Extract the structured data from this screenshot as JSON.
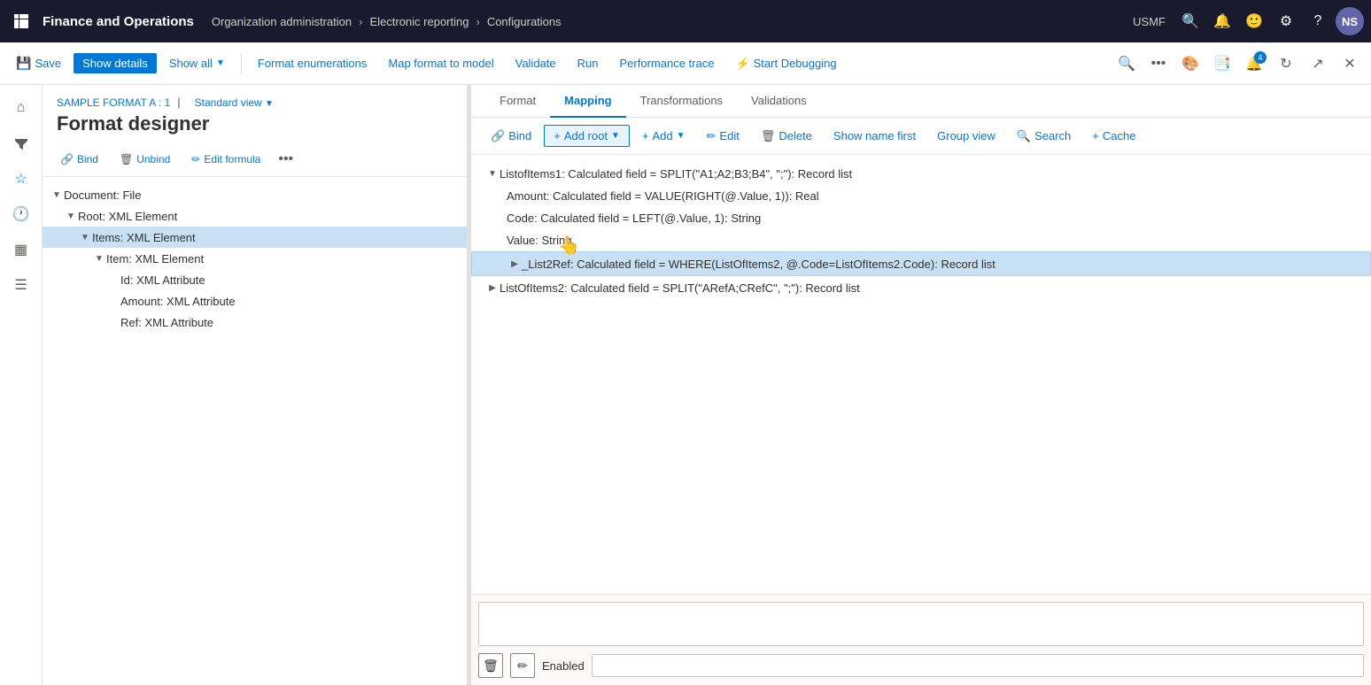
{
  "topBar": {
    "appTitle": "Finance and Operations",
    "breadcrumb": [
      {
        "label": "Organization administration"
      },
      {
        "label": "Electronic reporting"
      },
      {
        "label": "Configurations"
      }
    ],
    "orgLabel": "USMF",
    "avatarInitials": "NS"
  },
  "actionBar": {
    "saveLabel": "Save",
    "showDetailsLabel": "Show details",
    "showAllLabel": "Show all",
    "formatEnumerationsLabel": "Format enumerations",
    "mapFormatToModelLabel": "Map format to model",
    "validateLabel": "Validate",
    "runLabel": "Run",
    "performanceTraceLabel": "Performance trace",
    "startDebuggingLabel": "Start Debugging"
  },
  "pageHeader": {
    "sampleFormat": "SAMPLE FORMAT A : 1",
    "separator": "|",
    "standardView": "Standard view",
    "title": "Format designer"
  },
  "leftToolbar": {
    "bindLabel": "Bind",
    "unbindLabel": "Unbind",
    "editFormulaLabel": "Edit formula"
  },
  "formatTree": {
    "items": [
      {
        "id": "doc",
        "label": "Document: File",
        "indent": 0,
        "expanded": true,
        "selected": false
      },
      {
        "id": "root",
        "label": "Root: XML Element",
        "indent": 1,
        "expanded": true,
        "selected": false
      },
      {
        "id": "items",
        "label": "Items: XML Element",
        "indent": 2,
        "expanded": true,
        "selected": true
      },
      {
        "id": "item",
        "label": "Item: XML Element",
        "indent": 3,
        "expanded": true,
        "selected": false
      },
      {
        "id": "id",
        "label": "Id: XML Attribute",
        "indent": 4,
        "expanded": false,
        "selected": false
      },
      {
        "id": "amount-attr",
        "label": "Amount: XML Attribute",
        "indent": 4,
        "expanded": false,
        "selected": false
      },
      {
        "id": "ref",
        "label": "Ref: XML Attribute",
        "indent": 4,
        "expanded": false,
        "selected": false
      }
    ]
  },
  "tabs": [
    {
      "label": "Format",
      "active": false
    },
    {
      "label": "Mapping",
      "active": true
    },
    {
      "label": "Transformations",
      "active": false
    },
    {
      "label": "Validations",
      "active": false
    }
  ],
  "mappingToolbar": {
    "bindLabel": "Bind",
    "addRootLabel": "Add root",
    "addLabel": "Add",
    "editLabel": "Edit",
    "deleteLabel": "Delete",
    "showNameFirstLabel": "Show name first",
    "groupViewLabel": "Group view",
    "searchLabel": "Search",
    "cacheLabel": "Cache"
  },
  "mappingTree": {
    "items": [
      {
        "id": "listofitems1",
        "indent": 0,
        "expanded": true,
        "selected": false,
        "text": "ListofItems1: Calculated field = SPLIT(\"A1;A2;B3;B4\", \";\"): Record list"
      },
      {
        "id": "amount-calc",
        "indent": 1,
        "expanded": false,
        "selected": false,
        "text": "Amount: Calculated field = VALUE(RIGHT(@.Value, 1)): Real"
      },
      {
        "id": "code-calc",
        "indent": 1,
        "expanded": false,
        "selected": false,
        "text": "Code: Calculated field = LEFT(@.Value, 1): String"
      },
      {
        "id": "value-string",
        "indent": 1,
        "expanded": false,
        "selected": false,
        "text": "Value: String"
      },
      {
        "id": "list2ref",
        "indent": 1,
        "expanded": false,
        "selected": true,
        "text": "_List2Ref: Calculated field = WHERE(ListOfItems2, @.Code=ListOfItems2.Code): Record list"
      },
      {
        "id": "listofitems2",
        "indent": 0,
        "expanded": false,
        "selected": false,
        "text": "ListOfItems2: Calculated field = SPLIT(\"ARefA;CRefC\", \";\"): Record list"
      }
    ]
  },
  "bottomPanel": {
    "enabledLabel": "Enabled",
    "deleteIconChar": "🗑",
    "editIconChar": "✏"
  }
}
